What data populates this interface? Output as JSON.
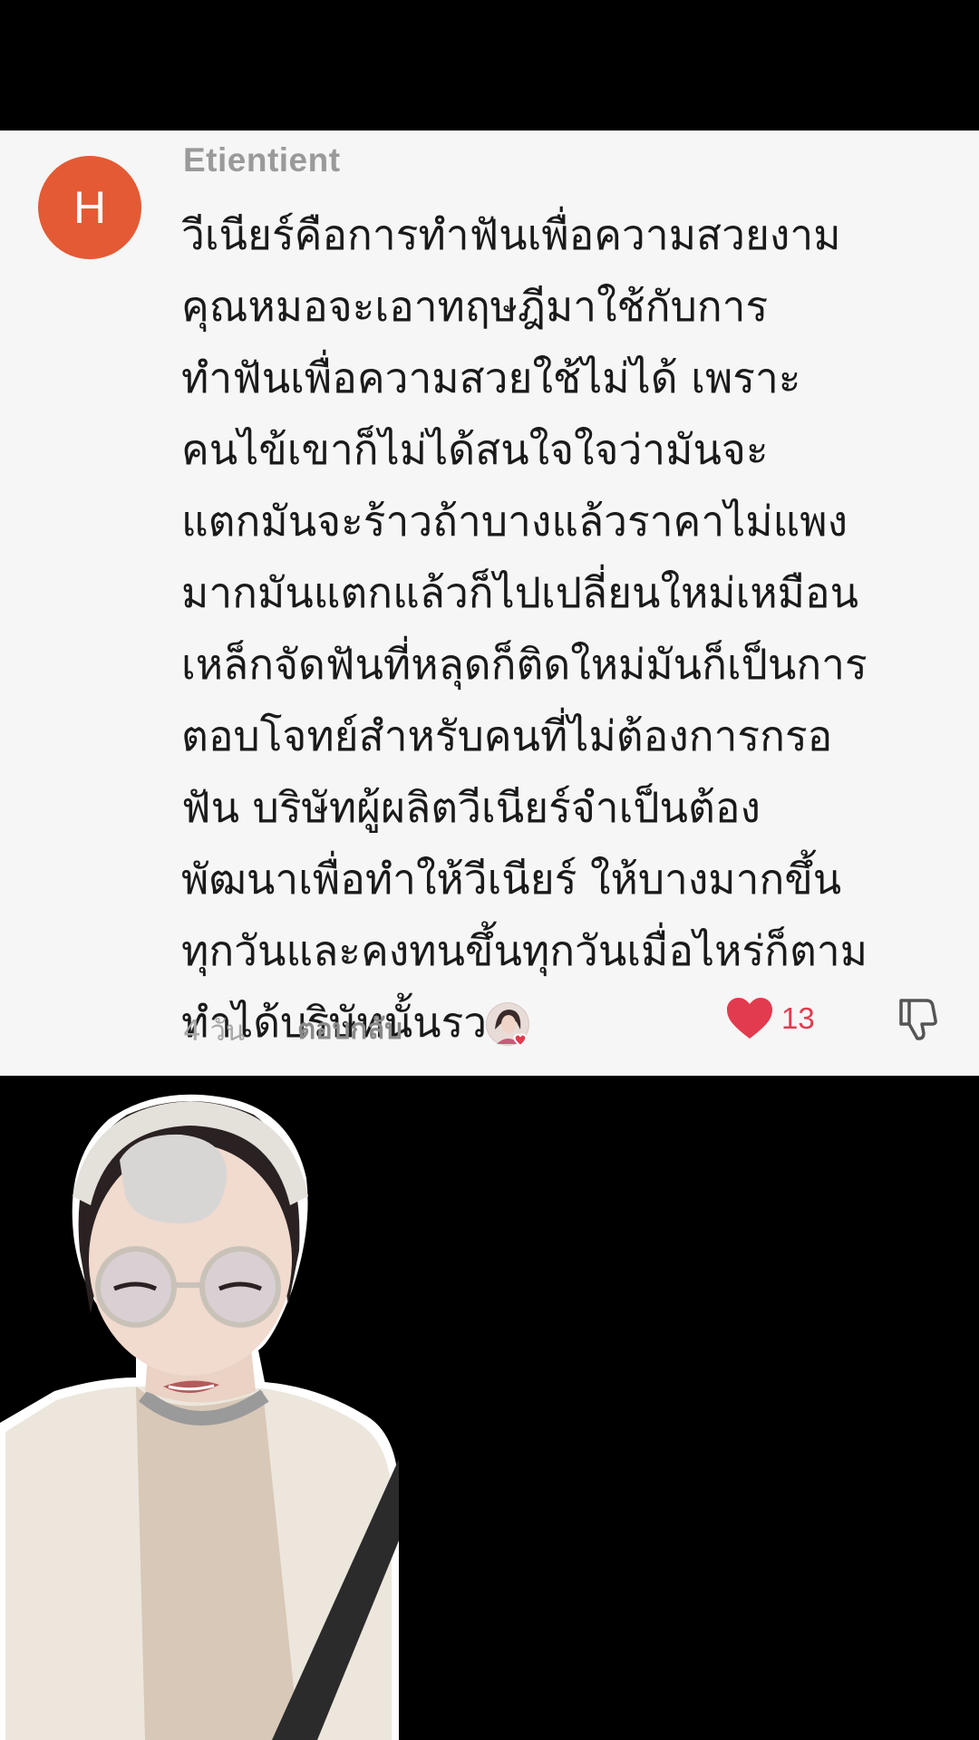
{
  "comment": {
    "avatar_letter": "H",
    "username": "Etientient",
    "text_lines": [
      "วีเนียร์คือการทำฟันเพื่อความสวยงาม",
      "คุณหมอจะเอาทฤษฎีมาใช้กับการ",
      "ทำฟันเพื่อความสวยใช้ไม่ได้ เพราะ",
      "คนไข้เขาก็ไม่ได้สนใจใจว่ามันจะ",
      "แตกมันจะร้าวถ้าบางแล้วราคาไม่แพง",
      "มากมันแตกแล้วก็ไปเปลี่ยนใหม่เหมือน",
      "เหล็กจัดฟันที่หลุดก็ติดใหม่มันก็เป็นการ",
      "ตอบโจทย์สำหรับคนที่ไม่ต้องการกรอ",
      "ฟัน บริษัทผู้ผลิตวีเนียร์จำเป็นต้อง",
      "พัฒนาเพื่อทำให้วีเนียร์ ให้บางมากขึ้น",
      "ทุกวันและคงทนขึ้นทุกวันเมื่อไหร่ก็ตาม",
      "ทำได้บริษัทนั้นรวย"
    ],
    "age": "4 วัน",
    "reply_label": "ตอบกลับ",
    "like_count": "13",
    "colors": {
      "avatar": "#e45a34",
      "like": "#e23a4e",
      "card_bg": "#f6f6f6"
    },
    "icons": [
      "heart-icon",
      "dislike-icon",
      "creator-liked-icon"
    ]
  }
}
